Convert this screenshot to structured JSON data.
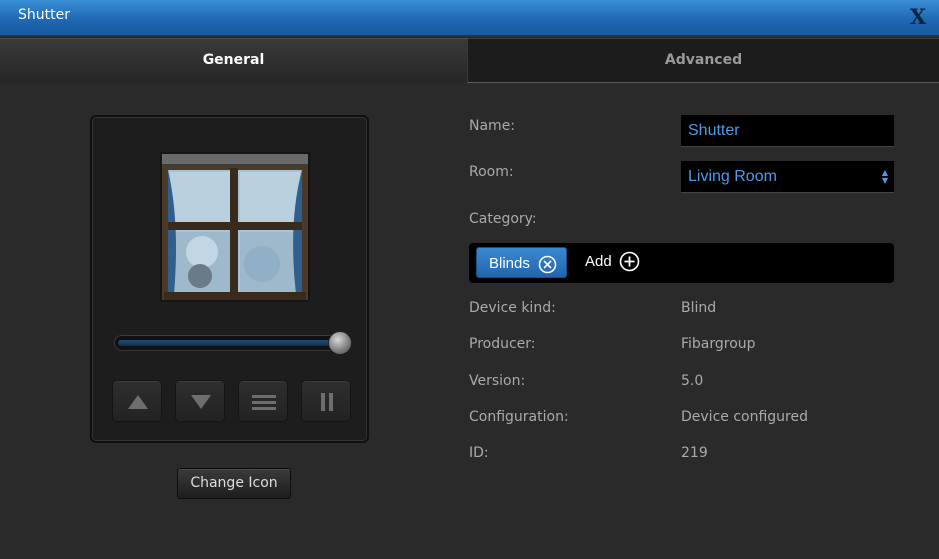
{
  "window": {
    "title": "Shutter",
    "close_label": "X"
  },
  "tabs": {
    "general": "General",
    "advanced": "Advanced"
  },
  "device_panel": {
    "icon": "window-blinds-icon",
    "slider_level": 0.98,
    "buttons": [
      "up-arrow-icon",
      "down-arrow-icon",
      "menu-lines-icon",
      "pause-icon"
    ],
    "change_icon_label": "Change Icon"
  },
  "form": {
    "name_label": "Name:",
    "name_value": "Shutter",
    "room_label": "Room:",
    "room_value": "Living Room",
    "category_label": "Category:",
    "category_chip": "Blinds",
    "add_label": "Add"
  },
  "info": {
    "device_kind_label": "Device kind:",
    "device_kind_value": "Blind",
    "producer_label": "Producer:",
    "producer_value": "Fibargroup",
    "version_label": "Version:",
    "version_value": "5.0",
    "configuration_label": "Configuration:",
    "configuration_value": "Device configured",
    "id_label": "ID:",
    "id_value": "219"
  },
  "colors": {
    "accent": "#2f7dc7",
    "titlebar": "#1f68b3",
    "link_text": "#4a9be8",
    "background": "#2a2a2a"
  }
}
